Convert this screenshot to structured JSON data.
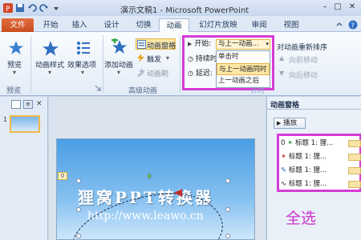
{
  "title_bar": {
    "title": "演示文稿1 - Microsoft PowerPoint",
    "minimize": "–",
    "maximize": "□",
    "close": "✕"
  },
  "tabs": [
    "文件",
    "开始",
    "插入",
    "设计",
    "切换",
    "动画",
    "幻灯片放映",
    "审阅",
    "视图"
  ],
  "active_tab": "动画",
  "ribbon": {
    "preview_label": "预览",
    "preview_group": "预览",
    "anim_style_label": "动画样式",
    "effect_options_label": "效果选项",
    "add_anim_label": "添加动画",
    "anim_pane_label": "动画窗格",
    "trigger_label": "触发",
    "anim_painter_label": "动画刷",
    "adv_group": "高级动画",
    "timing": {
      "start_label": "开始:",
      "start_value": "与上一动画...",
      "duration_label": "持续时",
      "delay_label": "延迟:",
      "options": [
        "单击时",
        "与上一动画同时",
        "上一动画之后"
      ],
      "selected_index": 1,
      "group_label": "计时"
    },
    "reorder_title": "对动画重新排序",
    "move_earlier": "向前移动",
    "move_later": "向后移动"
  },
  "slides_pane": {
    "slide_number": "1"
  },
  "slide": {
    "title": "狸窝PPT转换器",
    "url": "http://www.leawo.cn",
    "anim_badge": "0"
  },
  "animation_pane": {
    "title": "动画窗格",
    "play_label": "播放",
    "items": [
      {
        "index": "0",
        "label": "标题 1: 狸..."
      },
      {
        "index": "",
        "label": "标题 1: 狸..."
      },
      {
        "index": "",
        "label": "标题 1: 狸..."
      },
      {
        "index": "",
        "label": "标题 1: 狸..."
      }
    ],
    "annotation": "全选"
  },
  "colors": {
    "highlight": "#d63bd6",
    "file_tab": "#d55a2a"
  }
}
